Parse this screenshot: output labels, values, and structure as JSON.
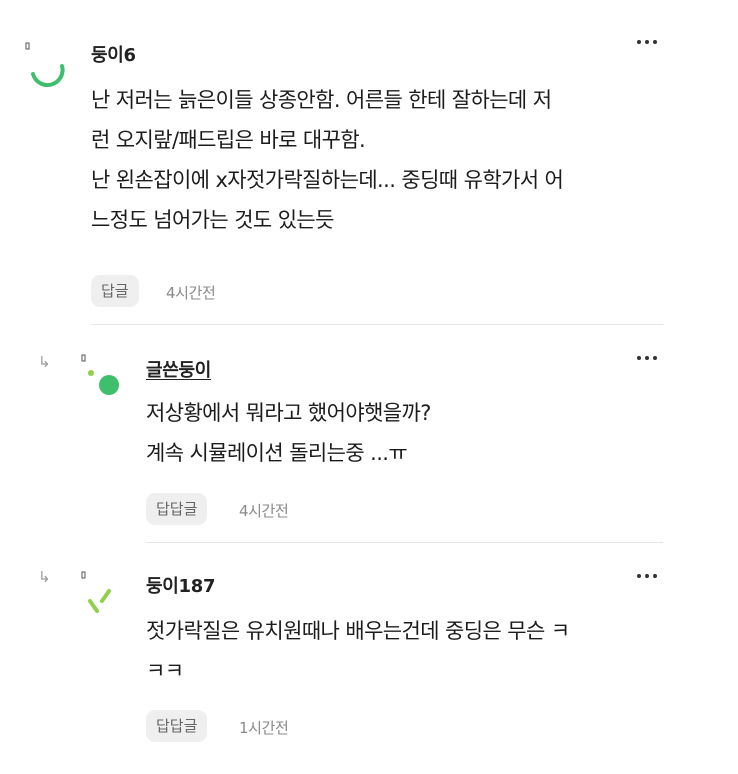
{
  "comments": [
    {
      "author": "둥이6",
      "lines": [
        "난 저러는 늙은이들 상종안함. 어른들 한테 잘하는데 저",
        "런 오지랖/패드립은 바로 대꾸함.",
        "난 왼손잡이에 x자젓가락질하는데... 중딩때 유학가서 어",
        "느정도 넘어가는 것도 있는듯"
      ],
      "reply_label": "답글",
      "time": "4시간전"
    },
    {
      "author": "글쓴둥이",
      "lines": [
        "저상황에서 뭐라고 했어야햇을까?",
        "계속 시뮬레이션 돌리는중 ...ㅠ"
      ],
      "reply_label": "답답글",
      "time": "4시간전"
    },
    {
      "author": "둥이187",
      "lines": [
        "젓가락질은 유치원때나 배우는건데 중딩은 무슨 ㅋ",
        "ㅋㅋ"
      ],
      "reply_label": "답답글",
      "time": "1시간전"
    }
  ],
  "icons": {
    "reply_arrow": "reply-arrow-icon",
    "more": "more-options-icon"
  },
  "colors": {
    "avatar_green": "#3fbf6e",
    "avatar_lime": "#8ed14a"
  }
}
